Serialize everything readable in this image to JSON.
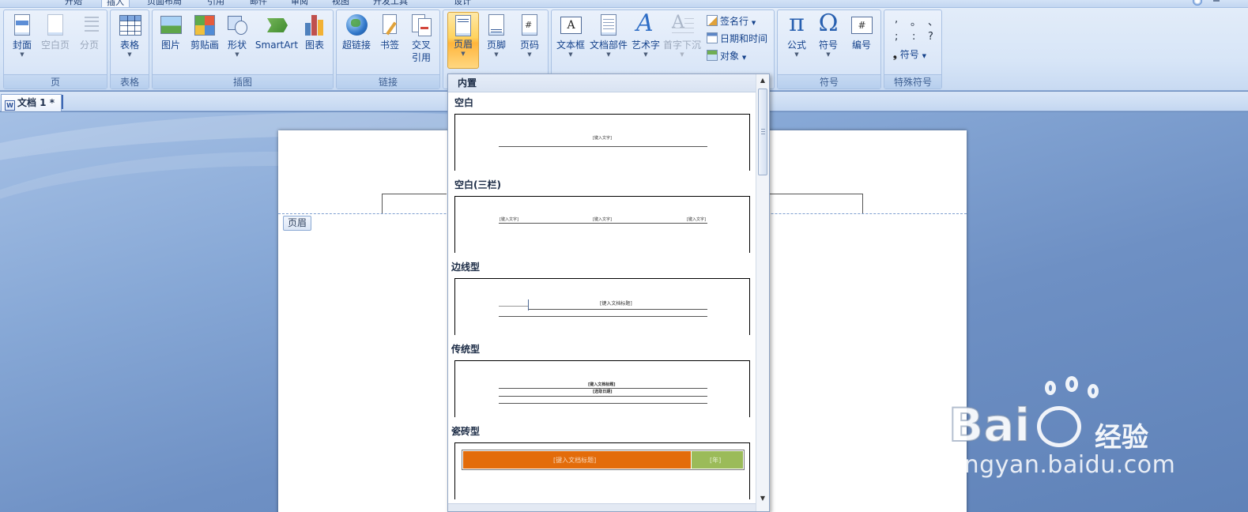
{
  "ribbon_tabs": [
    {
      "label": "开始",
      "active": false
    },
    {
      "label": "插入",
      "active": true
    },
    {
      "label": "页面布局",
      "active": false
    },
    {
      "label": "引用",
      "active": false
    },
    {
      "label": "邮件",
      "active": false
    },
    {
      "label": "审阅",
      "active": false
    },
    {
      "label": "视图",
      "active": false
    },
    {
      "label": "开发工具",
      "active": false
    },
    {
      "label": "设计",
      "active": false
    }
  ],
  "groups": {
    "pages": {
      "label": "页",
      "cover": "封面",
      "blank_page": "空白页",
      "page_break": "分页"
    },
    "tables": {
      "label": "表格",
      "table": "表格"
    },
    "illustrations": {
      "label": "插图",
      "picture": "图片",
      "clip_art": "剪贴画",
      "shapes": "形状",
      "smartart": "SmartArt",
      "chart": "图表"
    },
    "links": {
      "label": "链接",
      "hyperlink": "超链接",
      "bookmark": "书签",
      "cross_ref_1": "交叉",
      "cross_ref_2": "引用"
    },
    "header_footer": {
      "header": "页眉",
      "footer": "页脚",
      "page_number": "页码"
    },
    "text": {
      "textbox": "文本框",
      "quick_parts": "文档部件",
      "wordart": "艺术字",
      "drop_cap": "首字下沉",
      "signature_line": "签名行",
      "date_time": "日期和时间",
      "object": "对象"
    },
    "symbols": {
      "label": "符号",
      "equation": "公式",
      "symbol": "符号",
      "number": "编号"
    },
    "special_symbols": {
      "label": "特殊符号",
      "chars": [
        ",",
        "。",
        "、",
        ";",
        ":",
        "?"
      ],
      "symbol_btn": "符号"
    }
  },
  "document_tab": {
    "title": "文档 1 *",
    "icon_letter": "W"
  },
  "page": {
    "header_tag": "页眉"
  },
  "gallery": {
    "heading": "内置",
    "items": [
      {
        "title": "空白",
        "preview_texts": [
          "[键入文字]"
        ]
      },
      {
        "title": "空白(三栏)",
        "preview_texts": [
          "[键入文字]",
          "[键入文字]",
          "[键入文字]"
        ]
      },
      {
        "title": "边线型",
        "preview_texts": [
          "[键入文档标题]"
        ]
      },
      {
        "title": "传统型",
        "preview_texts": [
          "[键入文档标题]",
          "[选取日期]"
        ]
      },
      {
        "title": "瓷砖型",
        "preview_texts": [
          "[键入文档标题]",
          "[年]"
        ]
      }
    ],
    "tile_colors": {
      "orange": "#e36c0a",
      "green": "#9bbb59"
    }
  },
  "watermark": {
    "cn": "经验",
    "url": "jingyan.baidu.com"
  },
  "colors": {
    "ribbon_bg": "#dbe7f8",
    "accent_text": "#15428b",
    "selected_btn": "#ffd35e",
    "workspace": "#6e90c4"
  }
}
